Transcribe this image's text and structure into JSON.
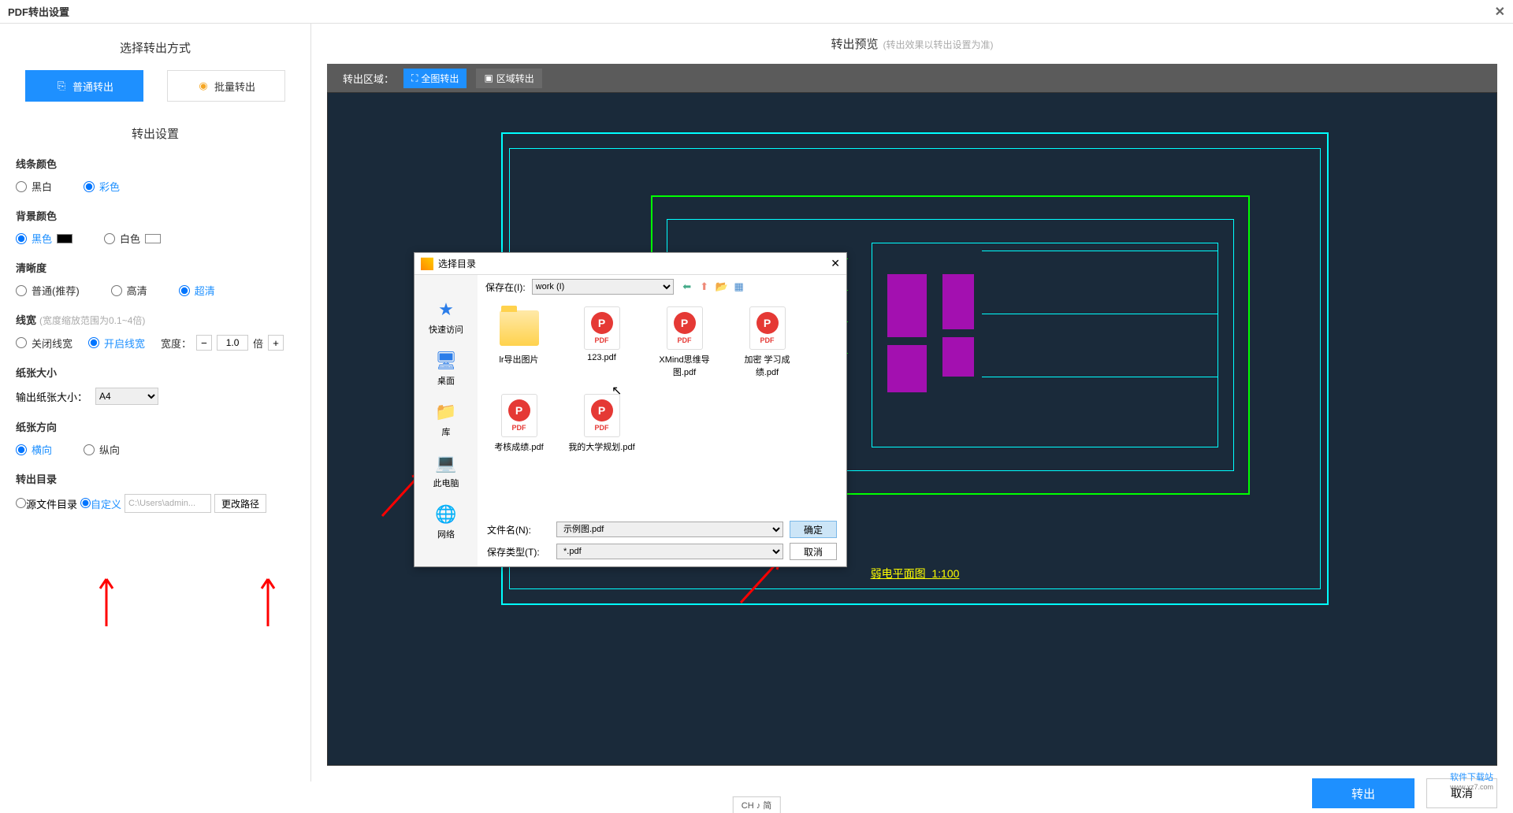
{
  "window": {
    "title": "PDF转出设置",
    "close": "✕"
  },
  "left": {
    "mode_title": "选择转出方式",
    "mode_normal": "普通转出",
    "mode_batch": "批量转出",
    "settings_title": "转出设置",
    "line_color": {
      "label": "线条颜色",
      "bw": "黑白",
      "color": "彩色"
    },
    "bg_color": {
      "label": "背景颜色",
      "black": "黑色",
      "white": "白色"
    },
    "clarity": {
      "label": "清晰度",
      "normal": "普通(推荐)",
      "hd": "高清",
      "uhd": "超清"
    },
    "linewidth": {
      "label": "线宽",
      "hint": "(宽度缩放范围为0.1~4倍)",
      "off": "关闭线宽",
      "on": "开启线宽",
      "width_label": "宽度：",
      "value": "1.0",
      "unit": "倍"
    },
    "paper_size": {
      "label": "纸张大小",
      "output_label": "输出纸张大小：",
      "value": "A4"
    },
    "orientation": {
      "label": "纸张方向",
      "landscape": "横向",
      "portrait": "纵向"
    },
    "output_dir": {
      "label": "转出目录",
      "source": "源文件目录",
      "custom": "自定义",
      "path": "C:\\Users\\admin...",
      "change": "更改路径"
    }
  },
  "preview": {
    "title": "转出预览",
    "hint": "(转出效果以转出设置为准)",
    "area_label": "转出区域：",
    "full": "全图转出",
    "region": "区域转出",
    "drawing_title": "弱电平面图",
    "drawing_scale": "1:100"
  },
  "dialog": {
    "title": "选择目录",
    "close": "✕",
    "save_in": "保存在(I):",
    "location": "work (I)",
    "sidebar": {
      "quick": "快速访问",
      "desktop": "桌面",
      "library": "库",
      "computer": "此电脑",
      "network": "网络"
    },
    "files": {
      "folder": "lr导出图片",
      "f1": "123.pdf",
      "f2": "XMind思维导图.pdf",
      "f3": "加密 学习成绩.pdf",
      "f4": "考核成绩.pdf",
      "f5": "我的大学规划.pdf"
    },
    "filename_label": "文件名(N):",
    "filename": "示例图.pdf",
    "filetype_label": "保存类型(T):",
    "filetype": "*.pdf",
    "ok": "确定",
    "cancel": "取消"
  },
  "footer": {
    "export": "转出",
    "cancel": "取消",
    "watermark1": "软件下载站",
    "watermark2": "www.xz7.com"
  },
  "ime": "CH ♪ 简"
}
